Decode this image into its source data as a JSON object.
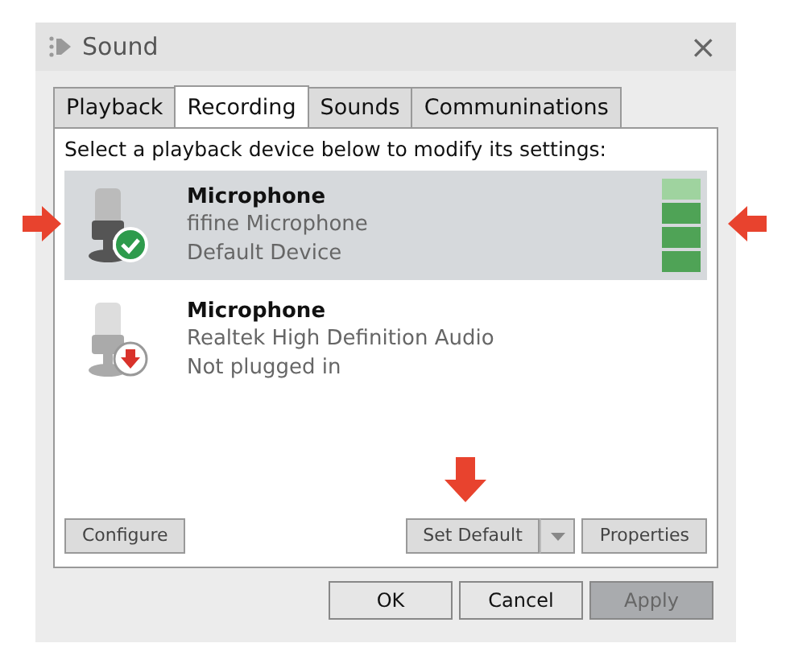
{
  "window": {
    "title": "Sound",
    "close": "×"
  },
  "tabs": [
    {
      "label": "Playback",
      "selected": false
    },
    {
      "label": "Recording",
      "selected": true
    },
    {
      "label": "Sounds",
      "selected": false
    },
    {
      "label": "Communinations",
      "selected": false
    }
  ],
  "instruction": "Select a playback device below to modify its settings:",
  "devices": [
    {
      "name": "Microphone",
      "detail": "fifine Microphone",
      "status": "Default Device",
      "kind": "default",
      "selected": true,
      "level": 0.75,
      "arrows": true
    },
    {
      "name": "Microphone",
      "detail": "Realtek High Definition Audio",
      "status": "Not plugged in",
      "kind": "unplugged",
      "selected": false
    }
  ],
  "panel_buttons": {
    "configure": "Configure",
    "set_default": "Set Default",
    "properties": "Properties",
    "set_default_arrow": true
  },
  "dialog_buttons": [
    {
      "label": "OK",
      "disabled": false
    },
    {
      "label": "Cancel",
      "disabled": false
    },
    {
      "label": "Apply",
      "disabled": true
    }
  ]
}
